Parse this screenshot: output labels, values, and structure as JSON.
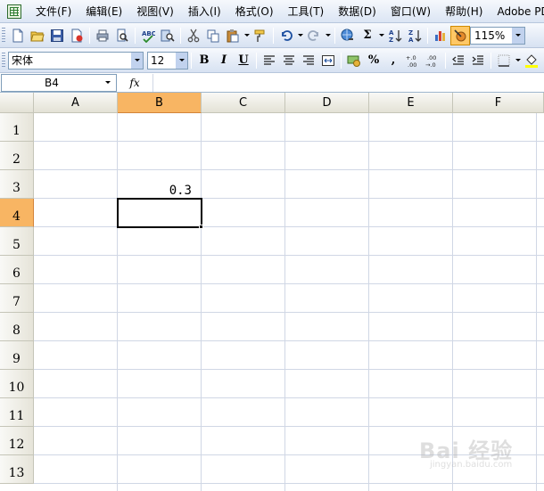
{
  "menu": {
    "items": [
      "文件(F)",
      "编辑(E)",
      "视图(V)",
      "插入(I)",
      "格式(O)",
      "工具(T)",
      "数据(D)",
      "窗口(W)",
      "帮助(H)",
      "Adobe PDF"
    ]
  },
  "toolbar": {
    "sum_symbol": "Σ",
    "zoom": "115%"
  },
  "format_toolbar": {
    "font_name": "宋体",
    "font_size": "12",
    "bold": "B",
    "italic": "I",
    "underline": "U",
    "percent": "%",
    "comma": ","
  },
  "formula_bar": {
    "name_box": "B4",
    "fx": "fx",
    "formula": ""
  },
  "sheet": {
    "columns": [
      "A",
      "B",
      "C",
      "D",
      "E",
      "F"
    ],
    "rows": [
      "1",
      "2",
      "3",
      "4",
      "5",
      "6",
      "7",
      "8",
      "9",
      "10",
      "11",
      "12",
      "13"
    ],
    "selected_column": "B",
    "selected_row": "4",
    "cells": [
      {
        "ref": "B3",
        "value": "0.3"
      }
    ]
  },
  "watermark": {
    "main": "Bai 经验",
    "sub": "jingyan.baidu.com"
  }
}
